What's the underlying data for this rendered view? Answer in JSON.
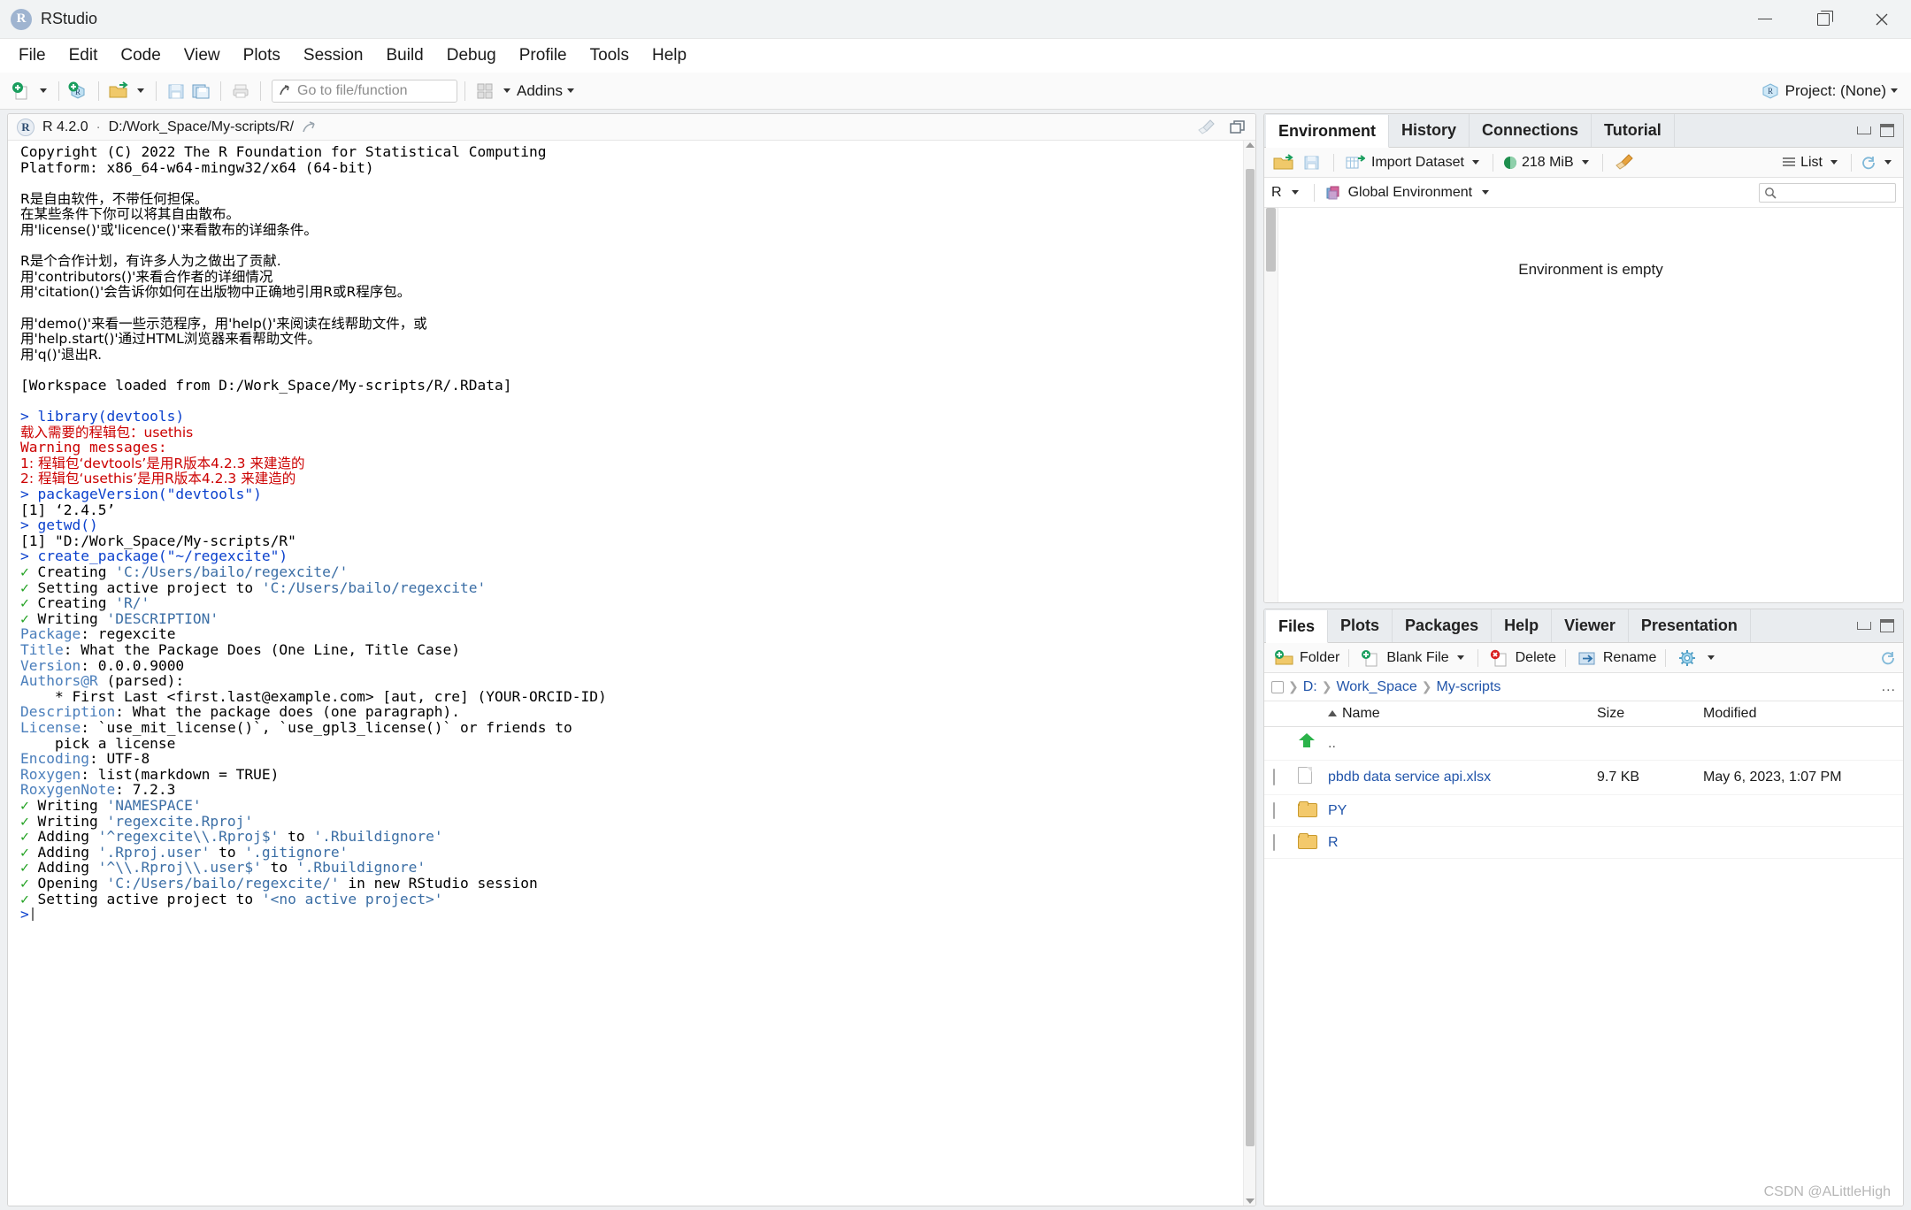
{
  "window": {
    "title": "RStudio",
    "logo_letter": "R",
    "buttons": {
      "minimize": "minimize-icon",
      "maximize": "maximize-icon",
      "close": "close-icon"
    }
  },
  "menubar": {
    "items": [
      "File",
      "Edit",
      "Code",
      "View",
      "Plots",
      "Session",
      "Build",
      "Debug",
      "Profile",
      "Tools",
      "Help"
    ]
  },
  "toolbar": {
    "new_file_icon": "new-file-icon",
    "new_project_icon": "new-project-icon",
    "open_file_icon": "open-folder-icon",
    "save_icon": "save-icon",
    "save_all_icon": "save-all-icon",
    "print_icon": "print-icon",
    "goto_placeholder": "Go to file/function",
    "goto_value": "",
    "workspace_panes_icon": "panes-layout-icon",
    "addins_label": "Addins",
    "project_label": "Project: (None)",
    "project_icon": "r-project-icon"
  },
  "console": {
    "header": {
      "r_logo": "r-logo-icon",
      "version": "R 4.2.0",
      "separator": "·",
      "path": "D:/Work_Space/My-scripts/R/",
      "popout_icon": "popout-icon",
      "broom_icon": "clear-console-icon",
      "maximize_icon": "maximize-pane-icon"
    },
    "lines": [
      {
        "segments": [
          {
            "t": "Copyright (C) 2022 The R Foundation for Statistical Computing",
            "c": "c-blk"
          }
        ]
      },
      {
        "segments": [
          {
            "t": "Platform: x86_64-w64-mingw32/x64 (64-bit)",
            "c": "c-blk"
          }
        ]
      },
      {
        "segments": []
      },
      {
        "segments": [
          {
            "t": "R是自由软件，不带任何担保。",
            "c": "c-blk",
            "cjk": true
          }
        ]
      },
      {
        "segments": [
          {
            "t": "在某些条件下你可以将其自由散布。",
            "c": "c-blk",
            "cjk": true
          }
        ]
      },
      {
        "segments": [
          {
            "t": "用'license()'或'licence()'来看散布的详细条件。",
            "c": "c-blk",
            "cjk": true
          }
        ]
      },
      {
        "segments": []
      },
      {
        "segments": [
          {
            "t": "R是个合作计划，有许多人为之做出了贡献.",
            "c": "c-blk",
            "cjk": true
          }
        ]
      },
      {
        "segments": [
          {
            "t": "用'contributors()'来看合作者的详细情况",
            "c": "c-blk",
            "cjk": true
          }
        ]
      },
      {
        "segments": [
          {
            "t": "用'citation()'会告诉你如何在出版物中正确地引用R或R程序包。",
            "c": "c-blk",
            "cjk": true
          }
        ]
      },
      {
        "segments": []
      },
      {
        "segments": [
          {
            "t": "用'demo()'来看一些示范程序，用'help()'来阅读在线帮助文件，或",
            "c": "c-blk",
            "cjk": true
          }
        ]
      },
      {
        "segments": [
          {
            "t": "用'help.start()'通过HTML浏览器来看帮助文件。",
            "c": "c-blk",
            "cjk": true
          }
        ]
      },
      {
        "segments": [
          {
            "t": "用'q()'退出R.",
            "c": "c-blk",
            "cjk": true
          }
        ]
      },
      {
        "segments": []
      },
      {
        "segments": [
          {
            "t": "[Workspace loaded from D:/Work_Space/My-scripts/R/.RData]",
            "c": "c-blk"
          }
        ]
      },
      {
        "segments": []
      },
      {
        "segments": [
          {
            "t": "> library(devtools)",
            "c": "c-cmd"
          }
        ]
      },
      {
        "segments": [
          {
            "t": "载入需要的程辑包：usethis",
            "c": "c-red",
            "cjk": true
          }
        ]
      },
      {
        "segments": [
          {
            "t": "Warning messages:",
            "c": "c-red"
          }
        ]
      },
      {
        "segments": [
          {
            "t": "1: 程辑包‘devtools’是用R版本4.2.3 来建造的",
            "c": "c-red",
            "cjk": true
          }
        ]
      },
      {
        "segments": [
          {
            "t": "2: 程辑包‘usethis’是用R版本4.2.3 来建造的",
            "c": "c-red",
            "cjk": true
          }
        ]
      },
      {
        "segments": [
          {
            "t": "> packageVersion(\"devtools\")",
            "c": "c-cmd"
          }
        ]
      },
      {
        "segments": [
          {
            "t": "[1] ‘2.4.5’",
            "c": "c-blk"
          }
        ]
      },
      {
        "segments": [
          {
            "t": "> getwd()",
            "c": "c-cmd"
          }
        ]
      },
      {
        "segments": [
          {
            "t": "[1] \"D:/Work_Space/My-scripts/R\"",
            "c": "c-blk"
          }
        ]
      },
      {
        "segments": [
          {
            "t": "> create_package(\"~/regexcite\")",
            "c": "c-cmd"
          }
        ]
      },
      {
        "segments": [
          {
            "t": "✓ ",
            "c": "c-grn"
          },
          {
            "t": "Creating ",
            "c": "c-blk"
          },
          {
            "t": "'C:/Users/bailo/regexcite/'",
            "c": "c-str"
          }
        ]
      },
      {
        "segments": [
          {
            "t": "✓ ",
            "c": "c-grn"
          },
          {
            "t": "Setting active project to ",
            "c": "c-blk"
          },
          {
            "t": "'C:/Users/bailo/regexcite'",
            "c": "c-str"
          }
        ]
      },
      {
        "segments": [
          {
            "t": "✓ ",
            "c": "c-grn"
          },
          {
            "t": "Creating ",
            "c": "c-blk"
          },
          {
            "t": "'R/'",
            "c": "c-str"
          }
        ]
      },
      {
        "segments": [
          {
            "t": "✓ ",
            "c": "c-grn"
          },
          {
            "t": "Writing ",
            "c": "c-blk"
          },
          {
            "t": "'DESCRIPTION'",
            "c": "c-str"
          }
        ]
      },
      {
        "segments": [
          {
            "t": "Package",
            "c": "c-key"
          },
          {
            "t": ": regexcite",
            "c": "c-blk"
          }
        ]
      },
      {
        "segments": [
          {
            "t": "Title",
            "c": "c-key"
          },
          {
            "t": ": What the Package Does (One Line, Title Case)",
            "c": "c-blk"
          }
        ]
      },
      {
        "segments": [
          {
            "t": "Version",
            "c": "c-key"
          },
          {
            "t": ": 0.0.0.9000",
            "c": "c-blk"
          }
        ]
      },
      {
        "segments": [
          {
            "t": "Authors@R",
            "c": "c-key"
          },
          {
            "t": " (parsed):",
            "c": "c-blk"
          }
        ]
      },
      {
        "segments": [
          {
            "t": "    * First Last <first.last@example.com> [aut, cre] (YOUR-ORCID-ID)",
            "c": "c-blk"
          }
        ]
      },
      {
        "segments": [
          {
            "t": "Description",
            "c": "c-key"
          },
          {
            "t": ": What the package does (one paragraph).",
            "c": "c-blk"
          }
        ]
      },
      {
        "segments": [
          {
            "t": "License",
            "c": "c-key"
          },
          {
            "t": ": `use_mit_license()`, `use_gpl3_license()` or friends to",
            "c": "c-blk"
          }
        ]
      },
      {
        "segments": [
          {
            "t": "    pick a license",
            "c": "c-blk"
          }
        ]
      },
      {
        "segments": [
          {
            "t": "Encoding",
            "c": "c-key"
          },
          {
            "t": ": UTF-8",
            "c": "c-blk"
          }
        ]
      },
      {
        "segments": [
          {
            "t": "Roxygen",
            "c": "c-key"
          },
          {
            "t": ": list(markdown = TRUE)",
            "c": "c-blk"
          }
        ]
      },
      {
        "segments": [
          {
            "t": "RoxygenNote",
            "c": "c-key"
          },
          {
            "t": ": 7.2.3",
            "c": "c-blk"
          }
        ]
      },
      {
        "segments": [
          {
            "t": "✓ ",
            "c": "c-grn"
          },
          {
            "t": "Writing ",
            "c": "c-blk"
          },
          {
            "t": "'NAMESPACE'",
            "c": "c-str"
          }
        ]
      },
      {
        "segments": [
          {
            "t": "✓ ",
            "c": "c-grn"
          },
          {
            "t": "Writing ",
            "c": "c-blk"
          },
          {
            "t": "'regexcite.Rproj'",
            "c": "c-str"
          }
        ]
      },
      {
        "segments": [
          {
            "t": "✓ ",
            "c": "c-grn"
          },
          {
            "t": "Adding ",
            "c": "c-blk"
          },
          {
            "t": "'^regexcite\\\\.Rproj$'",
            "c": "c-str"
          },
          {
            "t": " to ",
            "c": "c-blk"
          },
          {
            "t": "'.Rbuildignore'",
            "c": "c-str"
          }
        ]
      },
      {
        "segments": [
          {
            "t": "✓ ",
            "c": "c-grn"
          },
          {
            "t": "Adding ",
            "c": "c-blk"
          },
          {
            "t": "'.Rproj.user'",
            "c": "c-str"
          },
          {
            "t": " to ",
            "c": "c-blk"
          },
          {
            "t": "'.gitignore'",
            "c": "c-str"
          }
        ]
      },
      {
        "segments": [
          {
            "t": "✓ ",
            "c": "c-grn"
          },
          {
            "t": "Adding ",
            "c": "c-blk"
          },
          {
            "t": "'^\\\\.Rproj\\\\.user$'",
            "c": "c-str"
          },
          {
            "t": " to ",
            "c": "c-blk"
          },
          {
            "t": "'.Rbuildignore'",
            "c": "c-str"
          }
        ]
      },
      {
        "segments": [
          {
            "t": "✓ ",
            "c": "c-grn"
          },
          {
            "t": "Opening ",
            "c": "c-blk"
          },
          {
            "t": "'C:/Users/bailo/regexcite/'",
            "c": "c-str"
          },
          {
            "t": " in new RStudio session",
            "c": "c-blk"
          }
        ]
      },
      {
        "segments": [
          {
            "t": "✓ ",
            "c": "c-grn"
          },
          {
            "t": "Setting active project to ",
            "c": "c-blk"
          },
          {
            "t": "'<no active project>'",
            "c": "c-str"
          }
        ]
      },
      {
        "segments": [
          {
            "t": ">",
            "c": "c-cmd"
          }
        ],
        "cursor": true
      }
    ]
  },
  "environment_pane": {
    "tabs": [
      "Environment",
      "History",
      "Connections",
      "Tutorial"
    ],
    "active_tab": "Environment",
    "toolbar": {
      "load_icon": "load-workspace-icon",
      "save_icon": "save-workspace-icon",
      "import_icon": "import-dataset-icon",
      "import_label": "Import Dataset",
      "memory_icon": "memory-usage-icon",
      "memory_label": "218 MiB",
      "clear_icon": "broom-clear-icon",
      "list_icon": "list-view-icon",
      "list_label": "List",
      "refresh_icon": "refresh-icon"
    },
    "subbar": {
      "language_label": "R",
      "scope_icon": "global-environment-icon",
      "scope_label": "Global Environment",
      "search_icon": "search-icon",
      "search_placeholder": "",
      "search_value": ""
    },
    "empty_message": "Environment is empty"
  },
  "files_pane": {
    "tabs": [
      "Files",
      "Plots",
      "Packages",
      "Help",
      "Viewer",
      "Presentation"
    ],
    "active_tab": "Files",
    "toolbar": {
      "new_folder_icon": "new-folder-icon",
      "new_folder_label": "Folder",
      "blank_file_icon": "blank-file-icon",
      "blank_file_label": "Blank File",
      "delete_icon": "delete-icon",
      "delete_label": "Delete",
      "rename_icon": "rename-icon",
      "rename_label": "Rename",
      "more_icon": "gear-icon",
      "refresh_icon": "refresh-icon"
    },
    "breadcrumb": [
      "D:",
      "Work_Space",
      "My-scripts"
    ],
    "breadcrumb_more": "...",
    "columns": [
      "Name",
      "Size",
      "Modified"
    ],
    "sort_column": "Name",
    "rows": [
      {
        "icon": "up-directory-icon",
        "name": "..",
        "size": "",
        "modified": "",
        "checkbox": false,
        "is_parent": true
      },
      {
        "icon": "file-icon",
        "name": "pbdb data service api.xlsx",
        "size": "9.7 KB",
        "modified": "May 6, 2023, 1:07 PM",
        "checkbox": true,
        "is_parent": false
      },
      {
        "icon": "folder-icon",
        "name": "PY",
        "size": "",
        "modified": "",
        "checkbox": true,
        "is_parent": false
      },
      {
        "icon": "folder-icon",
        "name": "R",
        "size": "",
        "modified": "",
        "checkbox": true,
        "is_parent": false
      }
    ]
  },
  "watermark": "CSDN @ALittleHigh",
  "colors": {
    "accent_blue": "#0b41cd",
    "error_red": "#cc0000",
    "success_green": "#21a121",
    "string_blue": "#3b6ea5",
    "link_blue": "#2255aa"
  }
}
